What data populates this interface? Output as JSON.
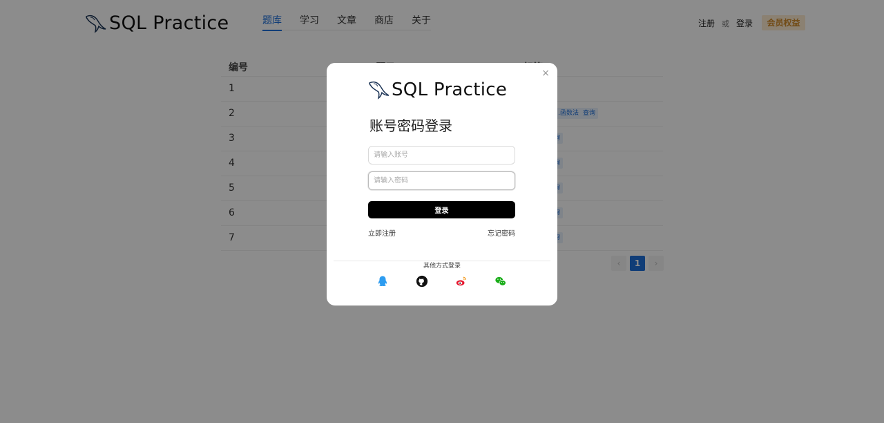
{
  "app": {
    "logo_text": "SQL Practice"
  },
  "nav": {
    "items": [
      "题库",
      "学习",
      "文章",
      "商店",
      "关于"
    ],
    "active_index": 0
  },
  "auth": {
    "register": "注册",
    "or": "或",
    "login": "登录",
    "vip": "会员权益"
  },
  "table": {
    "headers": [
      "编号",
      "题目",
      "标签"
    ],
    "rows": [
      "1",
      "2",
      "3",
      "4",
      "5",
      "6",
      "7"
    ],
    "row2_tags": [
      "…函数法",
      "查询"
    ],
    "tag_fragment": "询"
  },
  "pagination": {
    "prev": "‹",
    "current": "1",
    "next": "›"
  },
  "modal": {
    "close": "×",
    "logo_text": "SQL Practice",
    "title": "账号密码登录",
    "account_placeholder": "请输入账号",
    "password_placeholder": "请输入密码",
    "login_button": "登录",
    "register_link": "立即注册",
    "forgot_link": "忘记密码",
    "other_methods": "其他方式登录",
    "socials": [
      "qq-icon",
      "github-icon",
      "weibo-icon",
      "wechat-icon"
    ]
  },
  "colors": {
    "accent": "#1e6fd9",
    "vip_bg": "#fdebd0",
    "vip_text": "#d08a2a",
    "button": "#000000",
    "qq": "#2d9cf0",
    "weibo": "#e6162d",
    "wechat": "#1aad19"
  }
}
